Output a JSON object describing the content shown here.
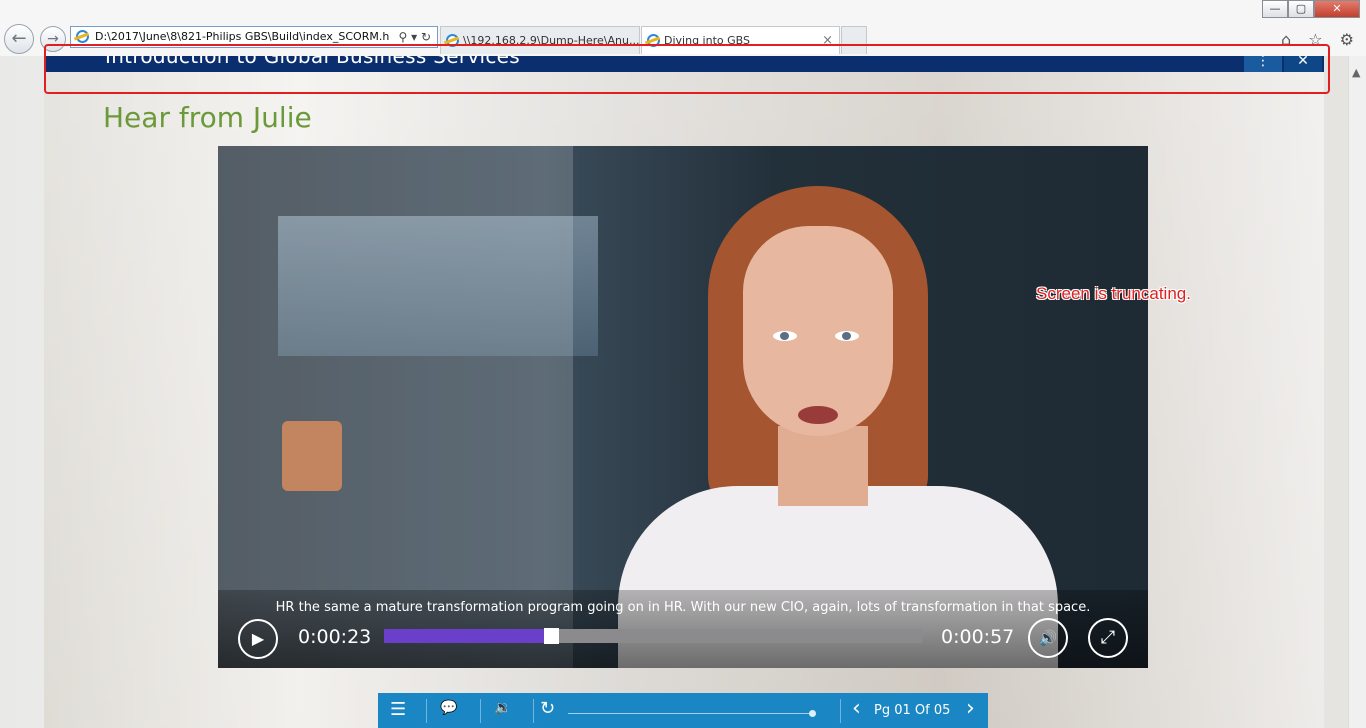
{
  "browser": {
    "address": "D:\\2017\\June\\8\\821-Philips GBS\\Build\\index_SCORM.h",
    "address_tools": "⚲ ▾ ↻",
    "tabs": [
      {
        "label": "\\\\192.168.2.9\\Dump-Here\\Anu..."
      },
      {
        "label": "Diving into GBS"
      }
    ],
    "tab_close": "×",
    "back": "←",
    "forward": "→",
    "window_buttons": {
      "minimize": "—",
      "maximize": "▢",
      "close": "✕"
    },
    "tools_icons": "⌂ ☆ ⚙"
  },
  "course": {
    "title": "Introduction to Global Business Services",
    "menu_icon": "⋮",
    "close_icon": "✕"
  },
  "section_title": "Hear from Julie",
  "video": {
    "subtitle": "HR the same a mature transformation program going on in HR. With our new CIO, again, lots of transformation in that space.",
    "current_time": "0:00:23",
    "total_time": "0:00:57",
    "progress_fraction": 0.31,
    "play_icon": "▶",
    "volume_icon": "🔊",
    "fullscreen_icon": "⤢"
  },
  "annotation": {
    "text": "Screen is truncating.",
    "color": "#e02020"
  },
  "bottom_bar": {
    "menu_icon": "☰",
    "chat_icon": "💬",
    "audio_icon": "🔉",
    "reload_icon": "↻",
    "prev_icon": "‹",
    "page_label": "Pg 01 Of 05",
    "next_icon": "›"
  },
  "colors": {
    "header_bg": "#0b2e6f",
    "title_green": "#6b9a3a",
    "progress": "#6a3fc9",
    "toolbar": "#1a87c4"
  }
}
